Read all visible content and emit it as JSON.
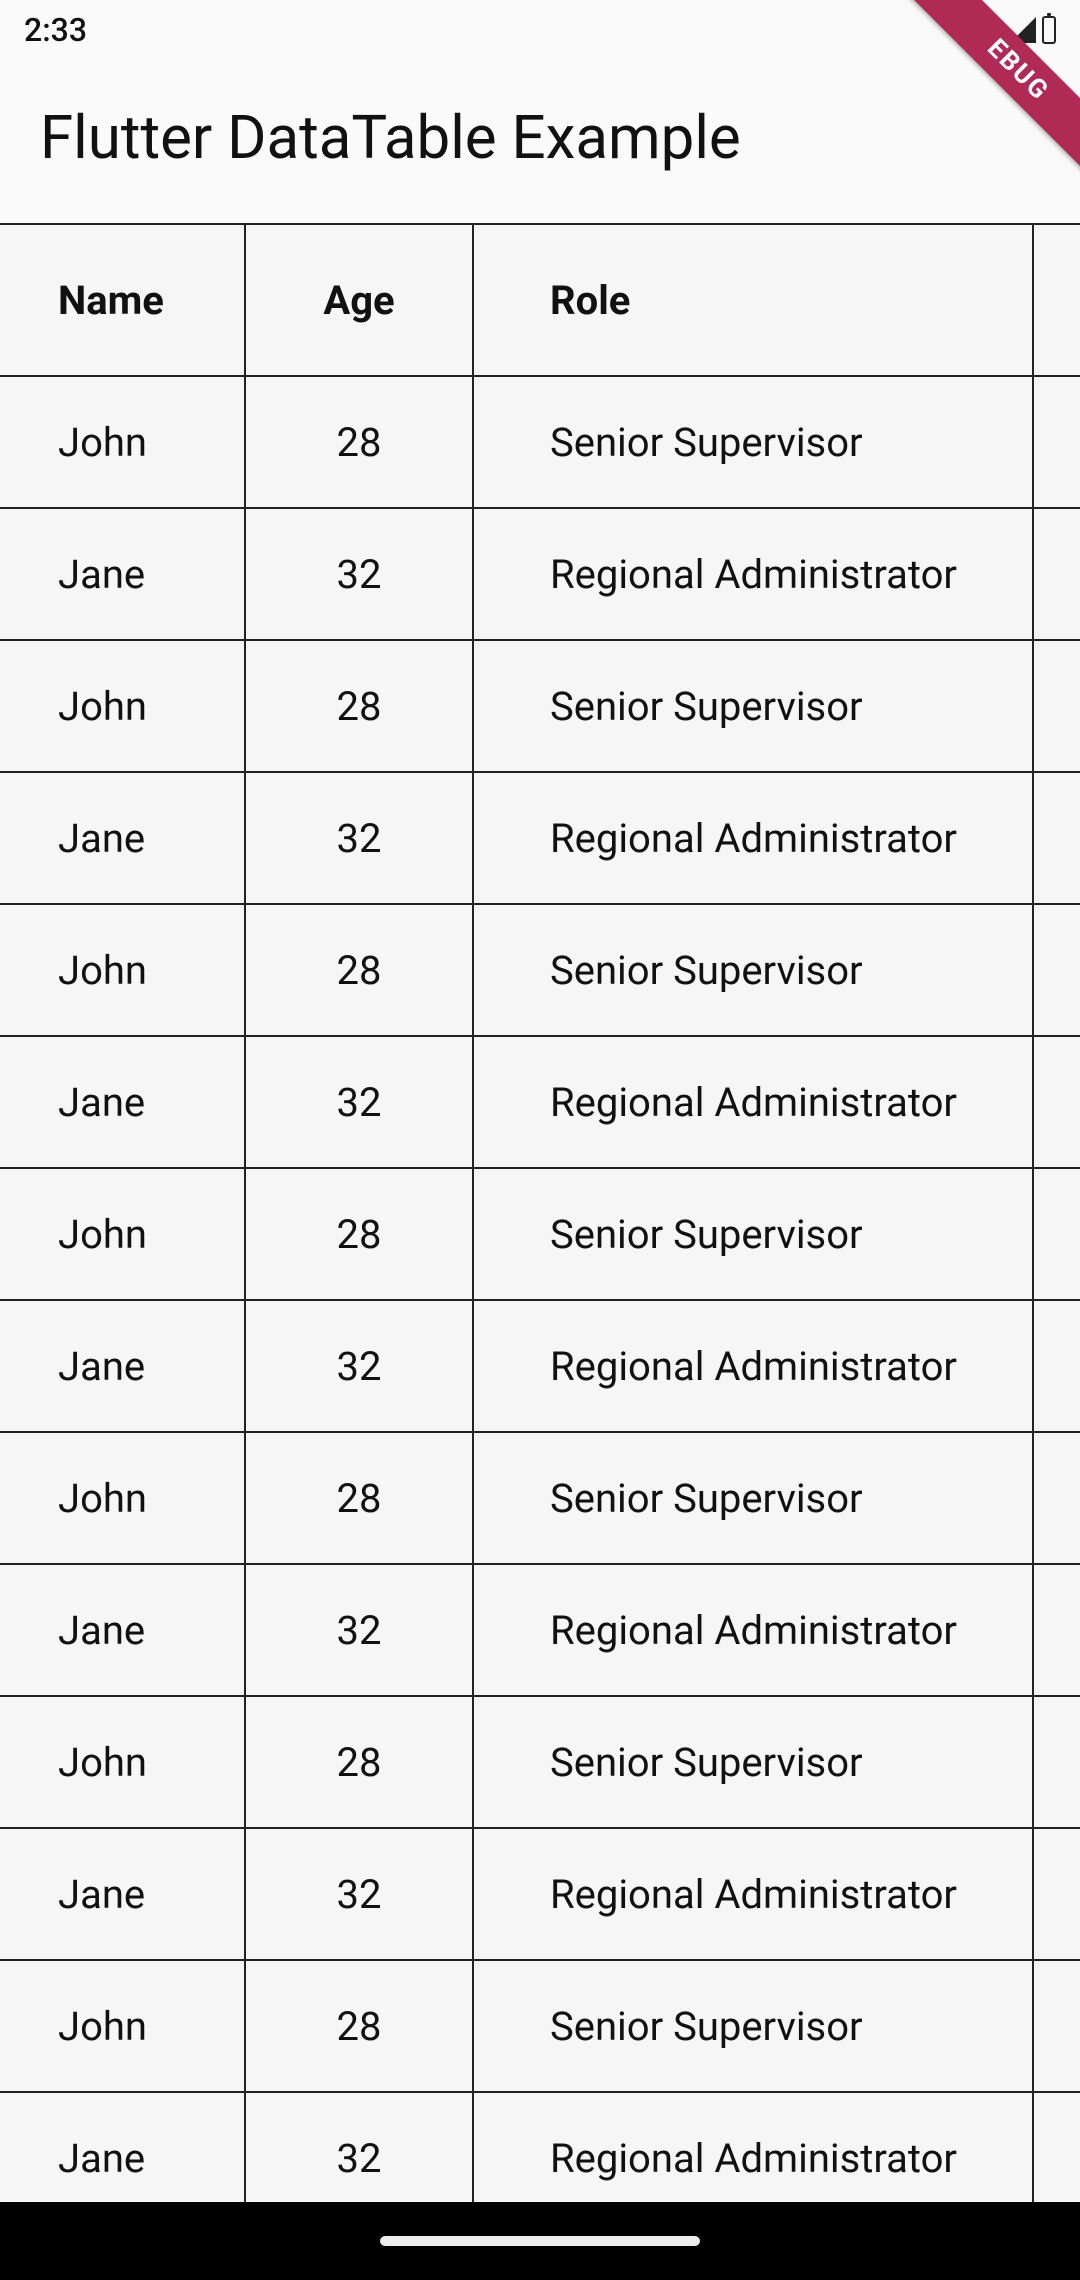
{
  "status": {
    "time": "2:33"
  },
  "debug_banner": "EBUG",
  "title": "Flutter DataTable Example",
  "table": {
    "headers": {
      "name": "Name",
      "age": "Age",
      "role": "Role"
    },
    "rows": [
      {
        "name": "John",
        "age": "28",
        "role": "Senior Supervisor"
      },
      {
        "name": "Jane",
        "age": "32",
        "role": "Regional Administrator"
      },
      {
        "name": "John",
        "age": "28",
        "role": "Senior Supervisor"
      },
      {
        "name": "Jane",
        "age": "32",
        "role": "Regional Administrator"
      },
      {
        "name": "John",
        "age": "28",
        "role": "Senior Supervisor"
      },
      {
        "name": "Jane",
        "age": "32",
        "role": "Regional Administrator"
      },
      {
        "name": "John",
        "age": "28",
        "role": "Senior Supervisor"
      },
      {
        "name": "Jane",
        "age": "32",
        "role": "Regional Administrator"
      },
      {
        "name": "John",
        "age": "28",
        "role": "Senior Supervisor"
      },
      {
        "name": "Jane",
        "age": "32",
        "role": "Regional Administrator"
      },
      {
        "name": "John",
        "age": "28",
        "role": "Senior Supervisor"
      },
      {
        "name": "Jane",
        "age": "32",
        "role": "Regional Administrator"
      },
      {
        "name": "John",
        "age": "28",
        "role": "Senior Supervisor"
      },
      {
        "name": "Jane",
        "age": "32",
        "role": "Regional Administrator"
      }
    ]
  }
}
